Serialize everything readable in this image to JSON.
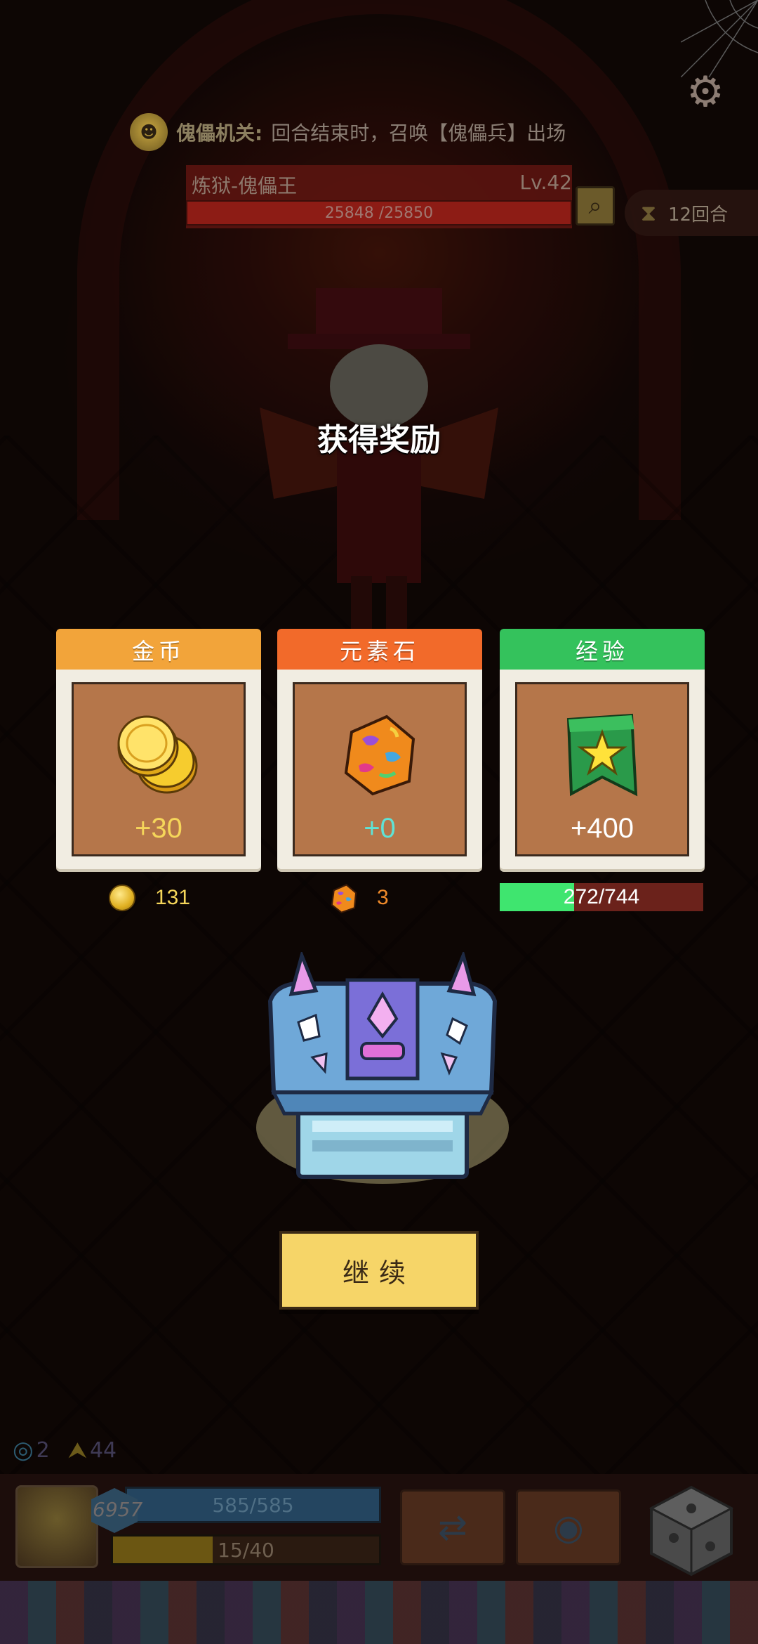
{
  "modifier": {
    "label": "傀儡机关:",
    "text": "回合结束时，召唤【傀儡兵】出场",
    "icon": "puppet-mask-icon"
  },
  "boss": {
    "name": "炼狱-傀儡王",
    "level": "Lv.42",
    "hp_text": "25848 /25850",
    "hp_fraction": 0.9999
  },
  "round": {
    "text": "12回合"
  },
  "reward": {
    "title": "获得奖励",
    "items": [
      {
        "header": "金币",
        "amount": "+30",
        "color": "#f2a43a",
        "icon": "gold-coin-icon"
      },
      {
        "header": "元素石",
        "amount": "+0",
        "color": "#f26a2a",
        "icon": "element-stone-icon"
      },
      {
        "header": "经验",
        "amount": "+400",
        "color": "#34c25c",
        "icon": "star-banner-icon"
      }
    ],
    "gold_total": "131",
    "stone_total": "3",
    "xp_text": "272/744",
    "xp_fraction": 0.3656,
    "continue_label": "继续"
  },
  "resources": {
    "eye_count": "2",
    "up_count": "44"
  },
  "player": {
    "power": "6957",
    "hp_text": "585/585",
    "energy_text": "15/40",
    "energy_fraction": 0.375
  }
}
